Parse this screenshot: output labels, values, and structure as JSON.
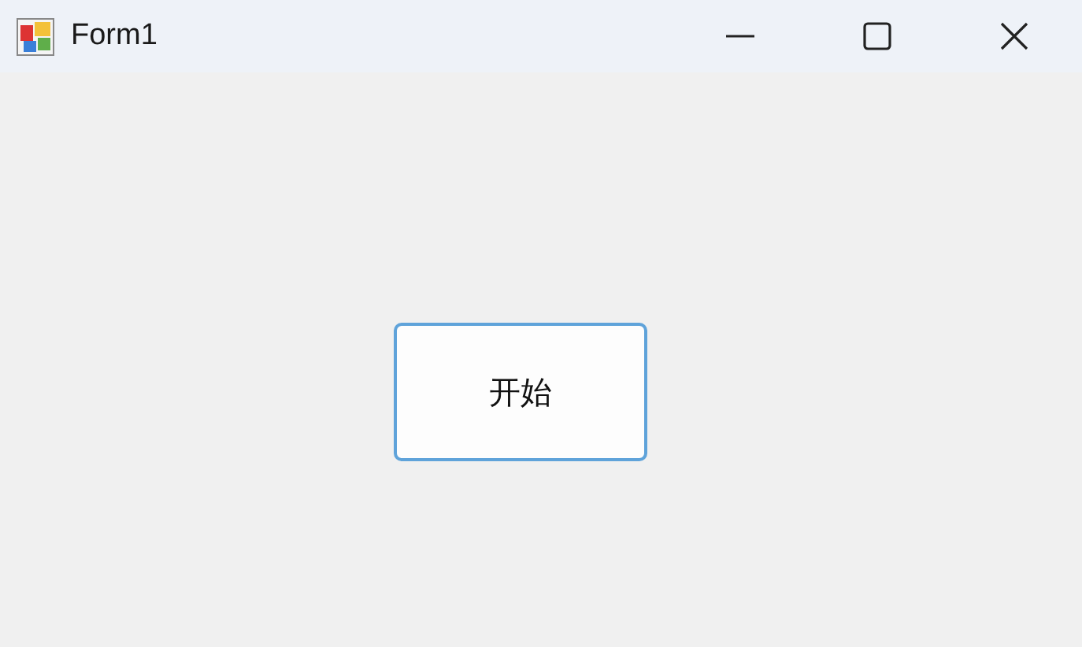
{
  "window": {
    "title": "Form1"
  },
  "buttons": [
    {
      "label": "开始",
      "focused": true
    }
  ]
}
